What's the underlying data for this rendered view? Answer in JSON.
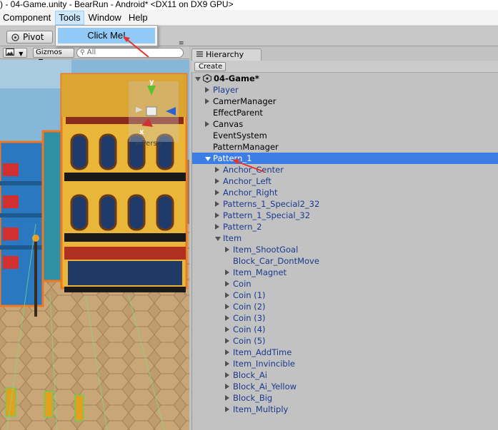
{
  "window": {
    "title": ") - 04-Game.unity - BearRun - Android* <DX11 on DX9 GPU>"
  },
  "menu": {
    "items": [
      {
        "label": "Component"
      },
      {
        "label": "Tools"
      },
      {
        "label": "Window"
      },
      {
        "label": "Help"
      }
    ],
    "open_index": 1,
    "dropdown": {
      "items": [
        {
          "label": "Click Me!"
        }
      ]
    }
  },
  "toolbar": {
    "pivot_label": "Pivot"
  },
  "scene": {
    "gizmos_label": "Gizmos",
    "search_value": "All",
    "persp_label": "←Persp",
    "axis_labels": {
      "y": "y",
      "x": "x"
    }
  },
  "hierarchy": {
    "tab_label": "Hierarchy",
    "create_label": "Create",
    "scene_name": "04-Game*",
    "rows": [
      {
        "label": "Player",
        "indent": 1,
        "arrow": "right",
        "prefab": true
      },
      {
        "label": "CamerManager",
        "indent": 1,
        "arrow": "right",
        "prefab": false
      },
      {
        "label": "EffectParent",
        "indent": 1,
        "arrow": "none",
        "prefab": false
      },
      {
        "label": "Canvas",
        "indent": 1,
        "arrow": "right",
        "prefab": false
      },
      {
        "label": "EventSystem",
        "indent": 1,
        "arrow": "none",
        "prefab": false
      },
      {
        "label": "PatternManager",
        "indent": 1,
        "arrow": "none",
        "prefab": false
      },
      {
        "label": "Pattern_1",
        "indent": 1,
        "arrow": "down",
        "prefab": true,
        "selected": true
      },
      {
        "label": "Anchor_Center",
        "indent": 2,
        "arrow": "right",
        "prefab": true
      },
      {
        "label": "Anchor_Left",
        "indent": 2,
        "arrow": "right",
        "prefab": true
      },
      {
        "label": "Anchor_Right",
        "indent": 2,
        "arrow": "right",
        "prefab": true
      },
      {
        "label": "Patterns_1_Special2_32",
        "indent": 2,
        "arrow": "right",
        "prefab": true
      },
      {
        "label": "Pattern_1_Special_32",
        "indent": 2,
        "arrow": "right",
        "prefab": true
      },
      {
        "label": "Pattern_2",
        "indent": 2,
        "arrow": "right",
        "prefab": true
      },
      {
        "label": "Item",
        "indent": 2,
        "arrow": "down",
        "prefab": true
      },
      {
        "label": "Item_ShootGoal",
        "indent": 3,
        "arrow": "right",
        "prefab": true
      },
      {
        "label": "Block_Car_DontMove",
        "indent": 3,
        "arrow": "none",
        "prefab": true
      },
      {
        "label": "Item_Magnet",
        "indent": 3,
        "arrow": "right",
        "prefab": true
      },
      {
        "label": "Coin",
        "indent": 3,
        "arrow": "right",
        "prefab": true
      },
      {
        "label": "Coin (1)",
        "indent": 3,
        "arrow": "right",
        "prefab": true
      },
      {
        "label": "Coin (2)",
        "indent": 3,
        "arrow": "right",
        "prefab": true
      },
      {
        "label": "Coin (3)",
        "indent": 3,
        "arrow": "right",
        "prefab": true
      },
      {
        "label": "Coin (4)",
        "indent": 3,
        "arrow": "right",
        "prefab": true
      },
      {
        "label": "Coin (5)",
        "indent": 3,
        "arrow": "right",
        "prefab": true
      },
      {
        "label": "Item_AddTime",
        "indent": 3,
        "arrow": "right",
        "prefab": true
      },
      {
        "label": "Item_Invincible",
        "indent": 3,
        "arrow": "right",
        "prefab": true
      },
      {
        "label": "Block_Ai",
        "indent": 3,
        "arrow": "right",
        "prefab": true
      },
      {
        "label": "Block_Ai_Yellow",
        "indent": 3,
        "arrow": "right",
        "prefab": true
      },
      {
        "label": "Block_Big",
        "indent": 3,
        "arrow": "right",
        "prefab": true
      },
      {
        "label": "Item_Multiply",
        "indent": 3,
        "arrow": "right",
        "prefab": true
      }
    ]
  },
  "colors": {
    "selection": "#3d7ee6",
    "prefab_text": "#1a3a8f",
    "menu_highlight": "#91c9f7",
    "annotation_arrow": "#e8302c",
    "selection_outline": "#f07820"
  },
  "icons": {
    "pivot": "pivot-icon",
    "scene_camera": "image-icon",
    "search": "search-icon",
    "unity_scene": "unity-logo-icon",
    "hierarchy_tab": "list-icon",
    "panel_menu": "menu-icon",
    "annotations": "red-arrow-annotation"
  }
}
